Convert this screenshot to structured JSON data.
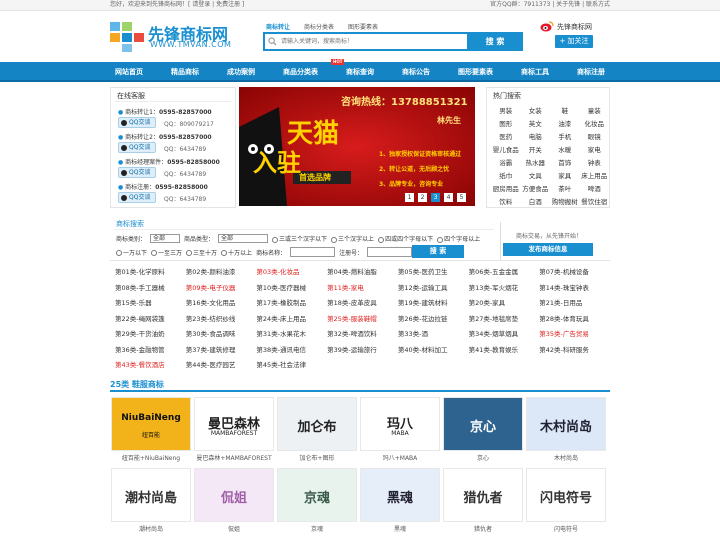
{
  "topbar": {
    "left": "您好，欢迎来到先锋商标网！[ 请登录 | 免费注册 ]",
    "right": "官方QQ群：7911373 | 关于先锋 | 联系方式"
  },
  "logo": {
    "name": "先锋商标网",
    "url_text": "WWW.TMVAN.COM"
  },
  "search": {
    "tabs": [
      "商标转让",
      "商标分类表",
      "图形要素表"
    ],
    "placeholder": "请输入关键词，搜索商标！",
    "button": "搜 索"
  },
  "weibo": {
    "label": "先锋商标网",
    "follow": "+ 加关注"
  },
  "nav": {
    "items": [
      "网站首页",
      "精品商标",
      "成功案例",
      "商品分类表",
      "商标查询",
      "商标公告",
      "图形要素表",
      "商标工具",
      "商标注册"
    ],
    "hot_badge": "HOT"
  },
  "online": {
    "title": "在线客服",
    "agents": [
      {
        "label": "商标转让1：",
        "phone": "0595-82857000",
        "qq_btn": "QQ交谈",
        "qq": "QQ：809079217"
      },
      {
        "label": "商标转让2：",
        "phone": "0595-82857000",
        "qq_btn": "QQ交谈",
        "qq": "QQ：6434789"
      },
      {
        "label": "商标经理案件：",
        "phone": "0595-82858000",
        "qq_btn": "QQ交谈",
        "qq": "QQ：6434789"
      },
      {
        "label": "商标注册：",
        "phone": "0595-82858000",
        "qq_btn": "QQ交谈",
        "qq": "QQ：6434789"
      }
    ]
  },
  "banner": {
    "hotline": "咨询热线：13788851321",
    "contact": "林先生",
    "big1": "天猫",
    "big2": "入驻",
    "sub": "首选品牌",
    "bullets": [
      "1、独家授权保证资格审核通过",
      "2、转让公道，无后顾之忧",
      "3、品牌专业，咨询专业"
    ],
    "pages": [
      "1",
      "2",
      "3",
      "4",
      "5"
    ],
    "active_page": "3"
  },
  "hot": {
    "title": "热门搜索",
    "words": [
      "男装",
      "女装",
      "鞋",
      "童装",
      "图形",
      "英文",
      "油漆",
      "化妆品",
      "医药",
      "电脑",
      "手机",
      "眼镜",
      "婴儿食品",
      "开关",
      "水暖",
      "家电",
      "浴霸",
      "热水器",
      "首饰",
      "钟表",
      "纸巾",
      "文具",
      "家具",
      "床上用品",
      "厨房用品",
      "方便食品",
      "茶叶",
      "啤酒",
      "饮料",
      "白酒",
      "购物搬树",
      "餐饮住宿"
    ]
  },
  "brand_search": {
    "title": "商标搜索",
    "type_label": "商标类别：",
    "type_value": "全部",
    "goods_label": "商品类型：",
    "goods_value": "全部",
    "radios": [
      "三或三个汉字以下",
      "三个汉字以上",
      "四或四个字母以下",
      "四个字母以上",
      "一万以下",
      "一至三万",
      "三至十万",
      "十万以上"
    ],
    "name_label": "商标名称：",
    "reg_label": "注册号：",
    "button": "搜 索",
    "notice": "商标交易，从先锋开始！",
    "publish": "发布商标信息"
  },
  "categories": [
    {
      "t": "第01类-化学原料",
      "hot": false
    },
    {
      "t": "第02类-颜料油漆",
      "hot": false
    },
    {
      "t": "第03类-化妆品",
      "hot": true
    },
    {
      "t": "第04类-燃料油脂",
      "hot": false
    },
    {
      "t": "第05类-医药卫生",
      "hot": false
    },
    {
      "t": "第06类-五金金属",
      "hot": false
    },
    {
      "t": "第07类-机械设备",
      "hot": false
    },
    {
      "t": "第08类-手工器械",
      "hot": false
    },
    {
      "t": "第09类-电子仪器",
      "hot": true
    },
    {
      "t": "第10类-医疗器械",
      "hot": false
    },
    {
      "t": "第11类-家电",
      "hot": true
    },
    {
      "t": "第12类-运输工具",
      "hot": false
    },
    {
      "t": "第13类-军火烟花",
      "hot": false
    },
    {
      "t": "第14类-珠宝钟表",
      "hot": false
    },
    {
      "t": "第15类-乐器",
      "hot": false
    },
    {
      "t": "第16类-文化用品",
      "hot": false
    },
    {
      "t": "第17类-橡胶制品",
      "hot": false
    },
    {
      "t": "第18类-皮革皮具",
      "hot": false
    },
    {
      "t": "第19类-建筑材料",
      "hot": false
    },
    {
      "t": "第20类-家具",
      "hot": false
    },
    {
      "t": "第21类-日用品",
      "hot": false
    },
    {
      "t": "第22类-绳网袋篷",
      "hot": false
    },
    {
      "t": "第23类-纺织纱线",
      "hot": false
    },
    {
      "t": "第24类-床上用品",
      "hot": false
    },
    {
      "t": "第25类-服装鞋帽",
      "hot": true
    },
    {
      "t": "第26类-花边拉链",
      "hot": false
    },
    {
      "t": "第27类-地毯席垫",
      "hot": false
    },
    {
      "t": "第28类-体育玩具",
      "hot": false
    },
    {
      "t": "第29类-干货油奶",
      "hot": false
    },
    {
      "t": "第30类-食品调味",
      "hot": false
    },
    {
      "t": "第31类-水果花木",
      "hot": false
    },
    {
      "t": "第32类-啤酒饮料",
      "hot": false
    },
    {
      "t": "第33类-酒",
      "hot": false
    },
    {
      "t": "第34类-烟草烟具",
      "hot": false
    },
    {
      "t": "第35类-广告贸易",
      "hot": true
    },
    {
      "t": "第36类-金融物管",
      "hot": false
    },
    {
      "t": "第37类-建筑修理",
      "hot": false
    },
    {
      "t": "第38类-通讯电信",
      "hot": false
    },
    {
      "t": "第39类-运输旅行",
      "hot": false
    },
    {
      "t": "第40类-材料加工",
      "hot": false
    },
    {
      "t": "第41类-教育娱乐",
      "hot": false
    },
    {
      "t": "第42类-科研服务",
      "hot": false
    },
    {
      "t": "第43类-餐饮酒店",
      "hot": true
    },
    {
      "t": "第44类-医疗园艺",
      "hot": false
    },
    {
      "t": "第45类-社会法律",
      "hot": false
    }
  ],
  "section": {
    "title": "25类 鞋服商标"
  },
  "trademarks": [
    {
      "logo_main": "NiuBaiNeng",
      "logo_sub": "纽百能",
      "caption": "纽百能+NiuBaiNeng",
      "bg": "#f2b21a",
      "fg": "#111"
    },
    {
      "logo_main": "曼巴森林",
      "logo_sub": "MAMBAFOREST",
      "caption": "曼巴森林+MAMBAFOREST",
      "bg": "#ffffff",
      "fg": "#222"
    },
    {
      "logo_main": "加仑布",
      "logo_sub": "",
      "caption": "加仑布+图形",
      "bg": "#eef1f3",
      "fg": "#222"
    },
    {
      "logo_main": "玛八",
      "logo_sub": "MABA",
      "caption": "玛八+MABA",
      "bg": "#ffffff",
      "fg": "#222"
    },
    {
      "logo_main": "京心",
      "logo_sub": "",
      "caption": "京心",
      "bg": "#2e6390",
      "fg": "#fff"
    },
    {
      "logo_main": "木村尚岛",
      "logo_sub": "",
      "caption": "木村尚岛",
      "bg": "#dce8f8",
      "fg": "#223"
    },
    {
      "logo_main": "潮村尚島",
      "logo_sub": "",
      "caption": "潮村尚岛",
      "bg": "#ffffff",
      "fg": "#333"
    },
    {
      "logo_main": "侃姐",
      "logo_sub": "",
      "caption": "侃姐",
      "bg": "#f4e7f6",
      "fg": "#a060a8"
    },
    {
      "logo_main": "京魂",
      "logo_sub": "",
      "caption": "京魂",
      "bg": "#e8f3ee",
      "fg": "#3a5a4a"
    },
    {
      "logo_main": "黑魂",
      "logo_sub": "",
      "caption": "黑魂",
      "bg": "#e6eefa",
      "fg": "#223"
    },
    {
      "logo_main": "猎仇者",
      "logo_sub": "",
      "caption": "猎仇者",
      "bg": "#ffffff",
      "fg": "#333"
    },
    {
      "logo_main": "闪电符号",
      "logo_sub": "",
      "caption": "闪电符号",
      "bg": "#ffffff",
      "fg": "#333"
    }
  ]
}
